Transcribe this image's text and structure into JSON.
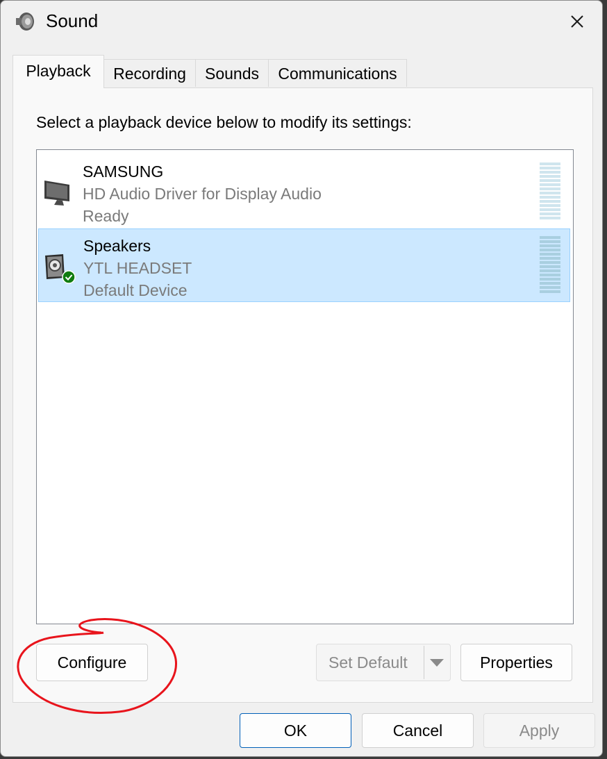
{
  "window": {
    "title": "Sound",
    "title_icon": "speaker-icon",
    "close_icon": "close-icon"
  },
  "tabs": [
    {
      "label": "Playback",
      "active": true
    },
    {
      "label": "Recording",
      "active": false
    },
    {
      "label": "Sounds",
      "active": false
    },
    {
      "label": "Communications",
      "active": false
    }
  ],
  "playback": {
    "instruction": "Select a playback device below to modify its settings:",
    "devices": [
      {
        "name": "SAMSUNG",
        "description": "HD Audio Driver for Display Audio",
        "status": "Ready",
        "icon": "monitor-icon",
        "selected": false,
        "default": false
      },
      {
        "name": "Speakers",
        "description": "YTL HEADSET",
        "status": "Default Device",
        "icon": "speaker-box-icon",
        "badge_icon": "green-check-icon",
        "selected": true,
        "default": true
      }
    ],
    "buttons": {
      "configure": "Configure",
      "set_default": "Set Default",
      "properties": "Properties"
    }
  },
  "footer": {
    "ok": "OK",
    "cancel": "Cancel",
    "apply": "Apply"
  },
  "colors": {
    "selection": "#cce8ff",
    "annotation": "#e8141c",
    "check": "#107c10",
    "meter": "#cfe5ee"
  }
}
